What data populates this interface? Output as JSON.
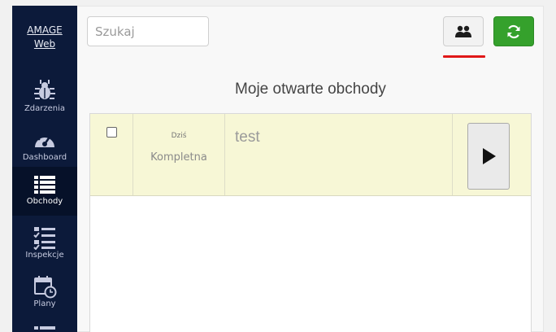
{
  "brand": {
    "line1": "AMAGE",
    "line2": "Web"
  },
  "sidebar": {
    "items": [
      {
        "label": "Zdarzenia",
        "icon": "bug-icon",
        "active": false
      },
      {
        "label": "Dashboard",
        "icon": "gauge-icon",
        "active": false
      },
      {
        "label": "Obchody",
        "icon": "list-icon",
        "active": true
      },
      {
        "label": "Inspekcje",
        "icon": "checklist-icon",
        "active": false
      },
      {
        "label": "Plany",
        "icon": "calendar-clock-icon",
        "active": false
      }
    ]
  },
  "search": {
    "placeholder": "Szukaj",
    "value": ""
  },
  "toolbar": {
    "users_icon": "users-icon",
    "refresh_icon": "refresh-icon"
  },
  "main": {
    "title": "Moje otwarte obchody",
    "rows": [
      {
        "date": "Dziś",
        "status": "Kompletna",
        "name": "test",
        "checked": false
      }
    ]
  },
  "colors": {
    "sidebar_bg": "#0c1a3a",
    "sidebar_active_bg": "#061129",
    "refresh_button": "#35a12c",
    "row_highlight": "#f7f7d6",
    "underline_accent": "#e01818"
  }
}
